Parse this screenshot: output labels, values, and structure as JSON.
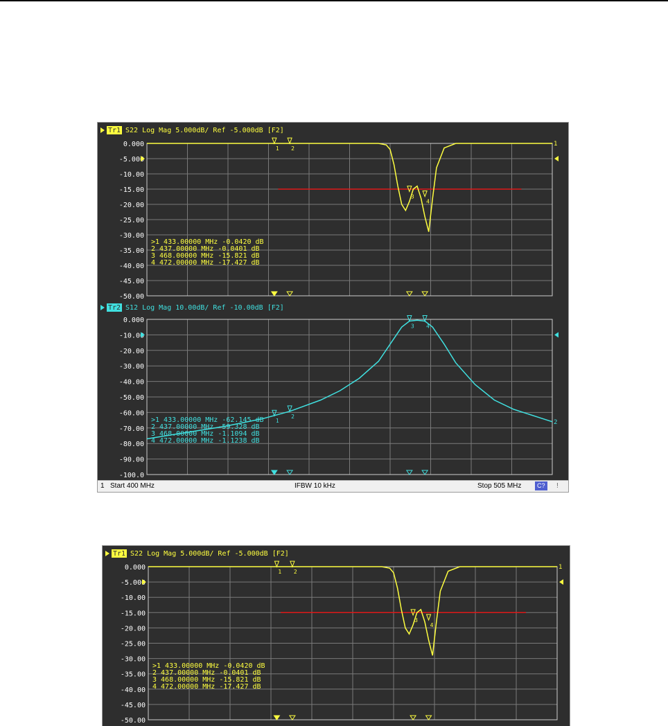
{
  "colors": {
    "background": "#2e2e2e",
    "grid": "#7a7a7a",
    "trace1": "#ffff40",
    "trace2": "#40e0e0",
    "limit_line": "#e01818",
    "statusbar": "#f0f0f0",
    "badge": "#4f5fd0"
  },
  "screenshots": [
    {
      "name": "screenshot-full",
      "panels": [
        {
          "name": "panel-s22",
          "header": {
            "trace_id": "Tr1",
            "text": "S22  Log Mag 5.000dB/ Ref -5.000dB [F2]"
          },
          "y_ticks": [
            "0.000",
            "-5.000",
            "-10.00",
            "-15.00",
            "-20.00",
            "-25.00",
            "-30.00",
            "-35.00",
            "-40.00",
            "-45.00",
            "-50.00"
          ],
          "markers": [
            {
              "id": "1",
              "label": ">1  433.00000 MHz  -0.0420 dB"
            },
            {
              "id": "2",
              "label": " 2  437.00000 MHz  -0.0401 dB"
            },
            {
              "id": "3",
              "label": " 3  468.00000 MHz  -15.821 dB"
            },
            {
              "id": "4",
              "label": " 4  472.00000 MHz  -17.427 dB"
            }
          ],
          "side_labels": {
            "left_ref_arrow": "-5.000",
            "right_end": "1"
          }
        },
        {
          "name": "panel-s12",
          "header": {
            "trace_id": "Tr2",
            "text": "S12  Log Mag 10.00dB/ Ref -10.00dB [F2]"
          },
          "y_ticks": [
            "0.000",
            "-10.00",
            "-20.00",
            "-30.00",
            "-40.00",
            "-50.00",
            "-60.00",
            "-70.00",
            "-80.00",
            "-90.00",
            "-100.0"
          ],
          "markers": [
            {
              "id": "1",
              "label": ">1  433.00000 MHz  -62.145 dB"
            },
            {
              "id": "2",
              "label": " 2  437.00000 MHz  -59.328 dB"
            },
            {
              "id": "3",
              "label": " 3  468.00000 MHz  -1.1094 dB"
            },
            {
              "id": "4",
              "label": " 4  472.00000 MHz  -1.1238 dB"
            }
          ],
          "side_labels": {
            "left_ref_arrow": "-10.00",
            "right_end": "2"
          }
        }
      ],
      "statusbar": {
        "channel": "1",
        "start": "Start 400 MHz",
        "ifbw": "IFBW 10 kHz",
        "stop": "Stop 505 MHz",
        "badge": "C?",
        "tail": "!"
      }
    },
    {
      "name": "screenshot-cropped",
      "panels": [
        {
          "name": "panel-s22-copy",
          "header": {
            "trace_id": "Tr1",
            "text": "S22  Log Mag 5.000dB/ Ref -5.000dB [F2]"
          },
          "y_ticks": [
            "0.000",
            "-5.000",
            "-10.00",
            "-15.00",
            "-20.00",
            "-25.00",
            "-30.00",
            "-35.00",
            "-40.00",
            "-45.00",
            "-50.00"
          ],
          "markers": [
            {
              "id": "1",
              "label": ">1  433.00000 MHz  -0.0420 dB"
            },
            {
              "id": "2",
              "label": " 2  437.00000 MHz  -0.0401 dB"
            },
            {
              "id": "3",
              "label": " 3  468.00000 MHz  -15.821 dB"
            },
            {
              "id": "4",
              "label": " 4  472.00000 MHz  -17.427 dB"
            }
          ],
          "side_labels": {
            "left_ref_arrow": "-5.000",
            "right_end": "1"
          }
        }
      ]
    }
  ],
  "chart_data": [
    {
      "type": "line",
      "title": "S22  Log Mag 5.000dB/ Ref -5.000dB [F2]",
      "x_unit": "MHz",
      "xlim": [
        400,
        505
      ],
      "ylim": [
        -50,
        0
      ],
      "grid": true,
      "series": [
        {
          "name": "S22",
          "x": [
            400,
            415,
            430,
            445,
            460,
            462,
            463,
            464,
            465,
            466,
            467,
            468,
            469,
            470,
            471,
            472,
            473,
            474,
            475,
            477,
            480,
            490,
            505
          ],
          "y": [
            0,
            0,
            0,
            0,
            0,
            -0.5,
            -2,
            -7,
            -14,
            -20,
            -22,
            -19,
            -15,
            -14,
            -18,
            -24,
            -29,
            -18,
            -8,
            -1.5,
            0,
            0,
            0
          ]
        }
      ],
      "limit_line": {
        "y": -15,
        "x_start": 434,
        "x_end": 497
      },
      "markers": [
        {
          "id": 1,
          "x": 433,
          "y": -0.042
        },
        {
          "id": 2,
          "x": 437,
          "y": -0.0401
        },
        {
          "id": 3,
          "x": 468,
          "y": -15.821
        },
        {
          "id": 4,
          "x": 472,
          "y": -17.427
        }
      ]
    },
    {
      "type": "line",
      "title": "S12  Log Mag 10.00dB/ Ref -10.00dB [F2]",
      "x_unit": "MHz",
      "xlim": [
        400,
        505
      ],
      "ylim": [
        -100,
        0
      ],
      "grid": true,
      "series": [
        {
          "name": "S12",
          "x": [
            400,
            410,
            420,
            430,
            437,
            445,
            450,
            455,
            460,
            463,
            466,
            468,
            470,
            472,
            474,
            477,
            480,
            485,
            490,
            495,
            505
          ],
          "y": [
            -77,
            -73,
            -69,
            -64,
            -59.3,
            -52,
            -46,
            -38,
            -27,
            -16,
            -5,
            -1.1,
            -0.6,
            -1.1,
            -5,
            -16,
            -28,
            -42,
            -52,
            -58,
            -66
          ]
        }
      ],
      "markers": [
        {
          "id": 1,
          "x": 433,
          "y": -62.145
        },
        {
          "id": 2,
          "x": 437,
          "y": -59.328
        },
        {
          "id": 3,
          "x": 468,
          "y": -1.1094
        },
        {
          "id": 4,
          "x": 472,
          "y": -1.1238
        }
      ]
    }
  ]
}
